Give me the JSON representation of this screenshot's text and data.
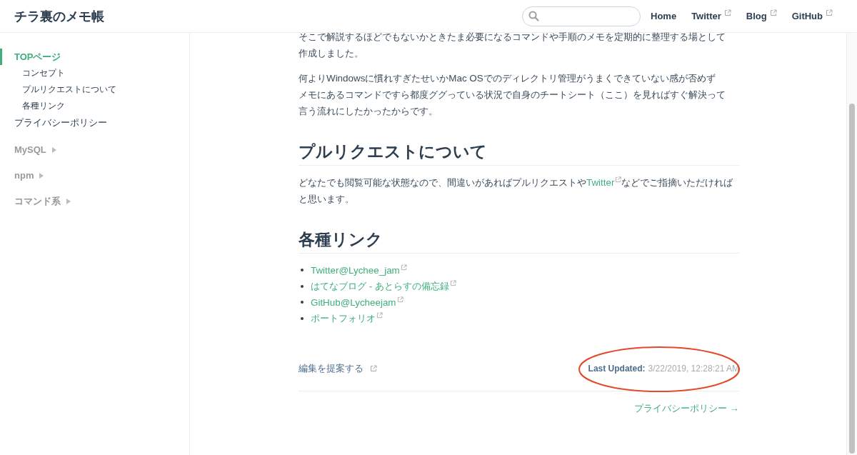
{
  "header": {
    "title": "チラ裏のメモ帳"
  },
  "nav": [
    {
      "label": "Home",
      "external": false
    },
    {
      "label": "Twitter",
      "external": true
    },
    {
      "label": "Blog",
      "external": true
    },
    {
      "label": "GitHub",
      "external": true
    }
  ],
  "sidebar": {
    "pages": [
      {
        "label": "TOPページ",
        "selected": true,
        "children": [
          {
            "label": "コンセプト",
            "selected": false
          },
          {
            "label": "プルリクエストについて",
            "selected": false
          },
          {
            "label": "各種リンク",
            "selected": false
          }
        ]
      },
      {
        "label": "プライバシーポリシー",
        "selected": false
      }
    ],
    "groups": [
      {
        "label": "MySQL",
        "expanded": false
      },
      {
        "label": "npm",
        "expanded": false
      },
      {
        "label": "コマンド系",
        "expanded": false
      }
    ]
  },
  "content": [
    {
      "kind": "paragraph",
      "lines": [
        "そこで解説するほどでもないかときたま必要になるコマンドや手順のメモを定期的に整理する場として",
        "作成しました。"
      ]
    },
    {
      "kind": "paragraph",
      "lines": [
        "何よりWindowsに慣れすぎたせいかMac OSでのディレクトリ管理がうまくできていない感が否めず",
        "メモにあるコマンドですら都度ググっている状況で自身のチートシート（ここ）を見ればすぐ解決って",
        "言う流れにしたかったからです。"
      ]
    },
    {
      "kind": "heading",
      "text": "プルリクエストについて"
    },
    {
      "kind": "rich_paragraph",
      "parts": [
        {
          "text": "どなたでも閲覧可能な状態なので、間違いがあればプルリクエストや",
          "link": false
        },
        {
          "text": "Twitter",
          "link": true
        },
        {
          "text": "などでご指摘いただければと思います。",
          "link": false
        }
      ]
    },
    {
      "kind": "heading",
      "text": "各種リンク"
    },
    {
      "kind": "links",
      "items": [
        {
          "label": "Twitter@Lychee_jam"
        },
        {
          "label": "はてなブログ - あとらすの備忘録"
        },
        {
          "label": "GitHub@Lycheejam"
        },
        {
          "label": "ポートフォリオ"
        }
      ]
    }
  ],
  "footer": {
    "edit_link": "編集を提案する",
    "last_updated_label": "Last Updated:",
    "last_updated": "3/22/2019, 12:28:21 AM",
    "next_link": "プライバシーポリシー →"
  }
}
